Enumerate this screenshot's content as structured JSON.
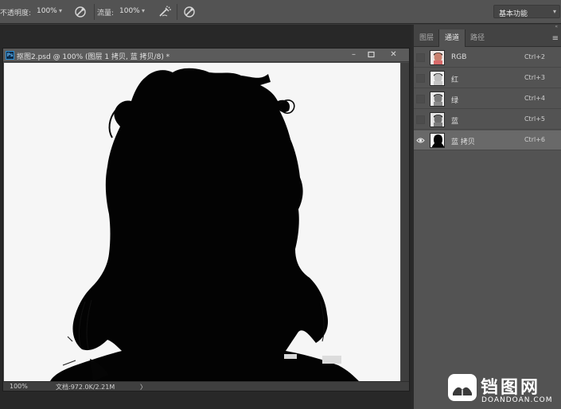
{
  "options_bar": {
    "opacity_label": "不透明度:",
    "opacity_value": "100%",
    "flow_label": "流量:",
    "flow_value": "100%",
    "workspace_label": "基本功能"
  },
  "document": {
    "title": "抠图2.psd @ 100% (图层 1 拷贝, 蓝 拷贝/8) *",
    "app_badge": "Ps",
    "zoom": "100%",
    "doc_info": "文档:972.0K/2.21M"
  },
  "panel": {
    "tabs": [
      {
        "label": "图层"
      },
      {
        "label": "通道"
      },
      {
        "label": "路径"
      }
    ],
    "active_tab": "通道",
    "channels": [
      {
        "name": "RGB",
        "shortcut": "Ctrl+2",
        "visible": false
      },
      {
        "name": "红",
        "shortcut": "Ctrl+3",
        "visible": false
      },
      {
        "name": "绿",
        "shortcut": "Ctrl+4",
        "visible": false
      },
      {
        "name": "蓝",
        "shortcut": "Ctrl+5",
        "visible": false
      },
      {
        "name": "蓝 拷贝",
        "shortcut": "Ctrl+6",
        "visible": true,
        "selected": true
      }
    ]
  },
  "watermark": {
    "chinese": "铛图网",
    "domain": "DOANDOAN.COM"
  }
}
